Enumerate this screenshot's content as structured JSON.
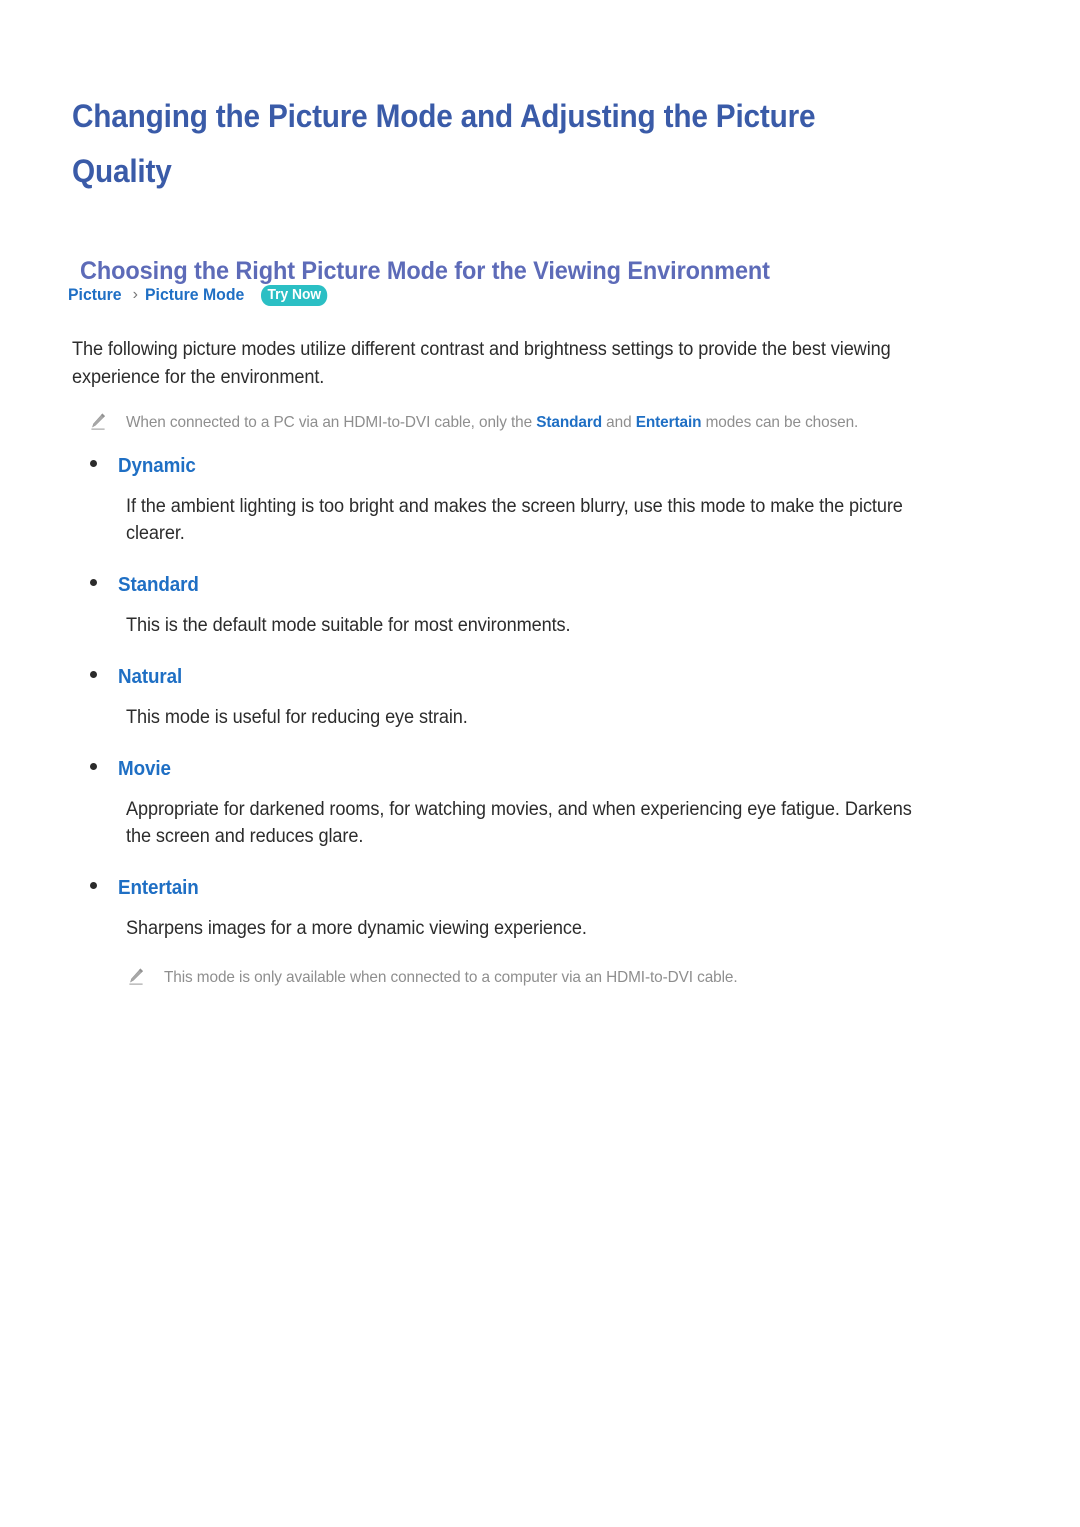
{
  "document": {
    "title": "Changing the Picture Mode and Adjusting the Picture Quality",
    "section_heading": "Choosing the Right Picture Mode for the Viewing Environment"
  },
  "breadcrumb": {
    "first": "Picture",
    "separator": "›",
    "second": "Picture Mode",
    "badge": "Try Now"
  },
  "intro": {
    "paragraph": "The following picture modes utilize different contrast and brightness settings to provide the best viewing experience for the environment."
  },
  "notes": {
    "top": {
      "icon": "pencil-icon",
      "before": "When connected to a PC via an HDMI-to-DVI cable, only the ",
      "highlight_1": "Standard",
      "middle": " and ",
      "highlight_2": "Entertain",
      "after": " modes can be chosen."
    },
    "bottom": {
      "icon": "pencil-icon",
      "text": "This mode is only available when connected to a computer via an HDMI-to-DVI cable."
    }
  },
  "modes": [
    {
      "label": "Dynamic",
      "description": "If the ambient lighting is too bright and makes the screen blurry, use this mode to make the picture clearer."
    },
    {
      "label": "Standard",
      "description": "This is the default mode suitable for most environments."
    },
    {
      "label": "Natural",
      "description": "This mode is useful for reducing eye strain."
    },
    {
      "label": "Movie",
      "description": "Appropriate for darkened rooms, for watching movies, and when experiencing eye fatigue. Darkens the screen and reduces glare."
    },
    {
      "label": "Entertain",
      "description": "Sharpens images for a more dynamic viewing experience."
    }
  ],
  "colors": {
    "title_blue": "#3a5ba8",
    "heading_purple_blue": "#5d6bb8",
    "link_blue": "#1f6fc4",
    "badge_teal": "#2bbfc4",
    "body_text": "#2c2c2c",
    "note_gray": "#8e8e8e"
  }
}
